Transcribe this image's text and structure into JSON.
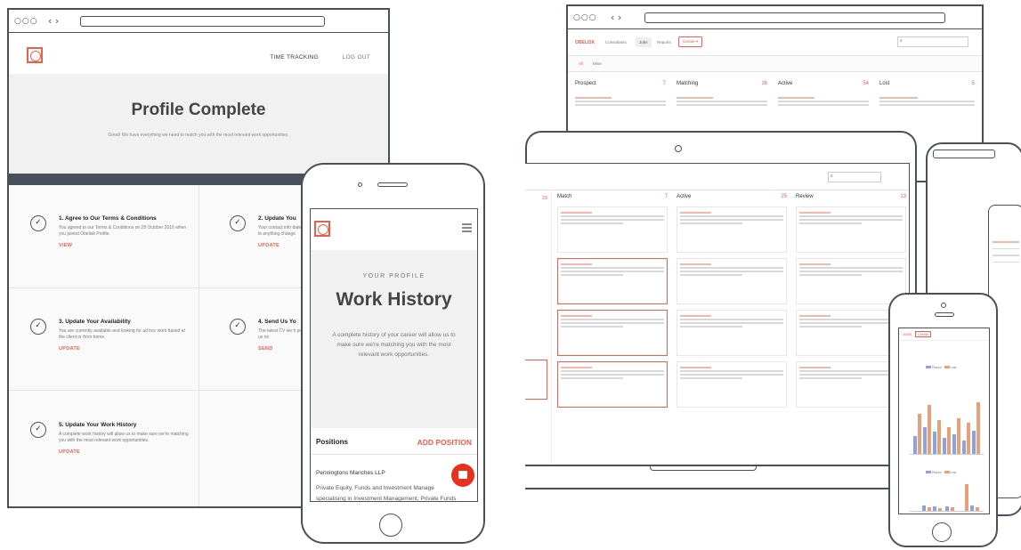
{
  "desktop": {
    "window_controls": "○○○",
    "nav_arrows": "‹  ›",
    "nav": [
      "TIME TRACKING",
      "LOG OUT"
    ],
    "hero_title": "Profile Complete",
    "hero_subtitle": "Great! We have everything we need to match you with the most relevant work opportunities.",
    "steps": [
      {
        "title": "1. Agree to Our Terms & Conditions",
        "desc": "You agreed to our Terms & Conditions on 28 October 2016 when you joined Obelisk Profile.",
        "link": "VIEW"
      },
      {
        "title": "2. Update You",
        "desc": "Your contact info date. Please le anything change",
        "link": "UPDATE"
      },
      {
        "title": "3. Update Your Availability",
        "desc": "You are currently available and looking for ad hoc work based at the client or from home.",
        "link": "UPDATE"
      },
      {
        "title": "4. Send Us Yo",
        "desc": "The latest CV we h provided to us on",
        "link": "SEND"
      },
      {
        "title": "5. Update Your Work History",
        "desc": "A complete work history will allow us to make sure we're matching you with the most relevant work opportunities.",
        "link": "UPDATE"
      }
    ]
  },
  "phone": {
    "eyebrow": "YOUR PROFILE",
    "title": "Work History",
    "desc": "A complete history of your career will allow us to make sure we're matching you with the most relevant work opportunities.",
    "positions_label": "Positions",
    "add_position": "ADD POSITION",
    "company": "Penningtons Manches LLP",
    "role_line1": "Private Equity, Funds and Investment Manage",
    "role_line2": "specialising in Investment Management, Private Funds"
  },
  "board": {
    "window_controls": "○○○",
    "nav_arrows": "‹  ›",
    "brand": "OBELISK",
    "tabs": [
      "Consultants",
      "Jobs",
      "Reports"
    ],
    "create": "Create ▾",
    "search_icon": "🔍",
    "subtabs": [
      "All",
      "Mine"
    ],
    "columns": [
      {
        "name": "Prospect",
        "count": "7"
      },
      {
        "name": "Matching",
        "count": "16"
      },
      {
        "name": "Active",
        "count": "54"
      },
      {
        "name": "Lost",
        "count": "5"
      }
    ]
  },
  "laptop": {
    "columns": [
      {
        "name": "Match",
        "count": "7"
      },
      {
        "name": "Active",
        "count": "25"
      },
      {
        "name": "Review",
        "count": "13"
      }
    ],
    "left_count": "23"
  },
  "small_phone": {
    "tabs": [
      "JOBS",
      "Create"
    ],
    "legend": [
      "Placed",
      "Lost"
    ]
  },
  "colors": {
    "accent": "#e8604c",
    "frame": "#4a4f5c",
    "bar_blue": "#8fa3d8",
    "bar_orange": "#e8a07a"
  }
}
